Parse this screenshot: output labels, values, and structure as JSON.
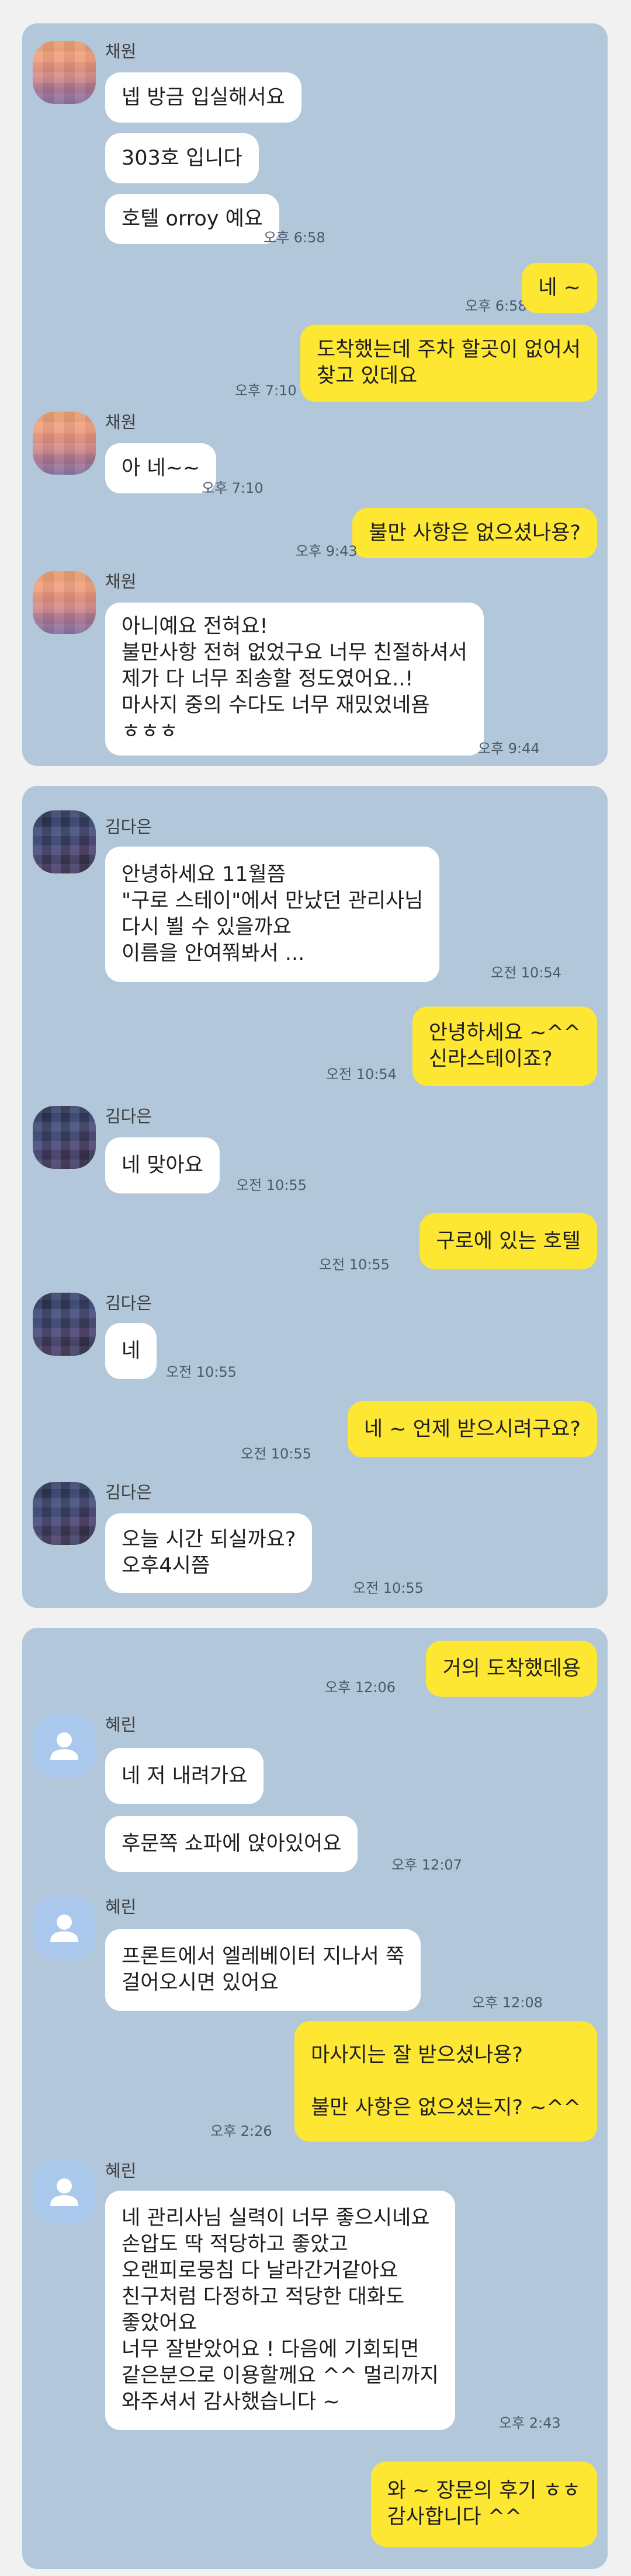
{
  "chat1": {
    "sender": "채원",
    "msg1": "넵 방금 입실해서요",
    "msg2": "303호 입니다",
    "msg3": "호텔 orroy 예요",
    "time1": "오후 6:58",
    "out1": "네 ~",
    "out1_time": "오후 6:58",
    "out2_line1": "도착했는데  주차 할곳이 없어서",
    "out2_line2": "찾고 있데요",
    "out2_time": "오후 7:10",
    "sender2": "채원",
    "msg4": "아 네~~",
    "time4": "오후 7:10",
    "out3": "불만 사항은 없으셨나용?",
    "out3_time": "오후 9:43",
    "sender3": "채원",
    "msg5_line1": "아니예요 전혀요!",
    "msg5_line2": "불만사항 전혀 없었구요 너무 친절하셔서",
    "msg5_line3": "제가 다 너무 죄송할 정도였어요..!",
    "msg5_line4": "마사지 중의 수다도 너무 재밌었네욤",
    "msg5_line5": "ㅎㅎㅎ",
    "time5": "오후 9:44"
  },
  "chat2": {
    "sender": "김다은",
    "msg1_line1": "안녕하세요 11월쯤",
    "msg1_line2": "\"구로 스테이\"에서 만났던 관리사님",
    "msg1_line3": "다시 뵐 수 있을까요",
    "msg1_line4": "이름을 안여쭤봐서 ...",
    "time1": "오전 10:54",
    "out1_line1": "안녕하세요 ~^^",
    "out1_line2": "신라스테이죠?",
    "out1_time": "오전 10:54",
    "sender2": "김다은",
    "msg2": "네 맞아요",
    "time2": "오전 10:55",
    "out2": "구로에 있는 호텔",
    "out2_time": "오전 10:55",
    "sender3": "김다은",
    "msg3": "네",
    "time3": "오전 10:55",
    "out3": "네 ~ 언제 받으시려구요?",
    "out3_time": "오전 10:55",
    "sender4": "김다은",
    "msg4_line1": "오늘  시간 되실까요?",
    "msg4_line2": "오후4시쯤",
    "time4": "오전 10:55"
  },
  "chat3": {
    "out1": "거의 도착했데용",
    "out1_time": "오후 12:06",
    "sender": "혜린",
    "msg1": "네 저 내려가요",
    "msg2": "후문쪽 쇼파에 앉아있어요",
    "time2": "오후 12:07",
    "sender2": "혜린",
    "msg3_line1": "프론트에서 엘레베이터 지나서 쭉",
    "msg3_line2": "걸어오시면 있어요",
    "time3": "오후 12:08",
    "out2_line1": "마사지는 잘 받으셨나용?",
    "out2_line2": "",
    "out2_line3": "불만 사항은 없으셨는지? ~^^",
    "out2_time": "오후 2:26",
    "sender3": "혜린",
    "msg4_line1": "네 관리사님 실력이 너무 좋으시네요",
    "msg4_line2": "손압도 딱 적당하고 좋았고",
    "msg4_line3": "오랜피로뭉침 다 날라간거같아요",
    "msg4_line4": "친구처럼 다정하고 적당한 대화도",
    "msg4_line5": "좋았어요",
    "msg4_line6": "너무 잘받았어요 ! 다음에 기회되면",
    "msg4_line7": "같은분으로 이용할께요 ^^ 멀리까지",
    "msg4_line8": "와주셔서 감사했습니다 ~",
    "time4": "오후 2:43",
    "out3_line1": "와 ~ 장문의 후기 ㅎㅎ",
    "out3_line2": "감사합니다 ^^",
    "colors": {
      "background": "#b2c7da",
      "outgoing": "#fee733",
      "incoming": "#ffffff"
    }
  }
}
